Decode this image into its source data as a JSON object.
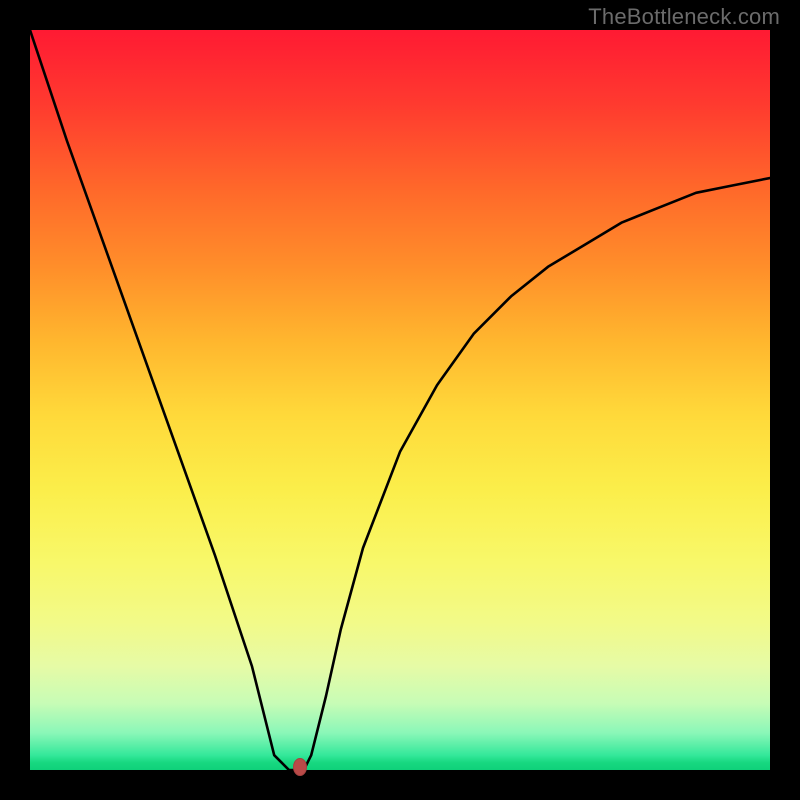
{
  "watermark_text": "TheBottleneck.com",
  "chart_data": {
    "type": "line",
    "title": "",
    "xlabel": "",
    "ylabel": "",
    "xlim": [
      0,
      100
    ],
    "ylim": [
      0,
      100
    ],
    "grid": false,
    "legend": false,
    "background": "rainbow-vertical-gradient",
    "series": [
      {
        "name": "curve",
        "color": "#000000",
        "x": [
          0,
          5,
          10,
          15,
          20,
          25,
          30,
          33,
          34,
          35,
          36,
          37,
          38,
          40,
          42,
          45,
          50,
          55,
          60,
          65,
          70,
          75,
          80,
          85,
          90,
          95,
          100
        ],
        "y": [
          100,
          85,
          71,
          57,
          43,
          29,
          14,
          2,
          1,
          0,
          0,
          0,
          2,
          10,
          19,
          30,
          43,
          52,
          59,
          64,
          68,
          71,
          74,
          76,
          78,
          79,
          80
        ]
      }
    ],
    "annotations": [
      {
        "name": "minimum-marker",
        "type": "point",
        "x": 36.5,
        "y": 0,
        "color": "#b94a48"
      }
    ]
  }
}
